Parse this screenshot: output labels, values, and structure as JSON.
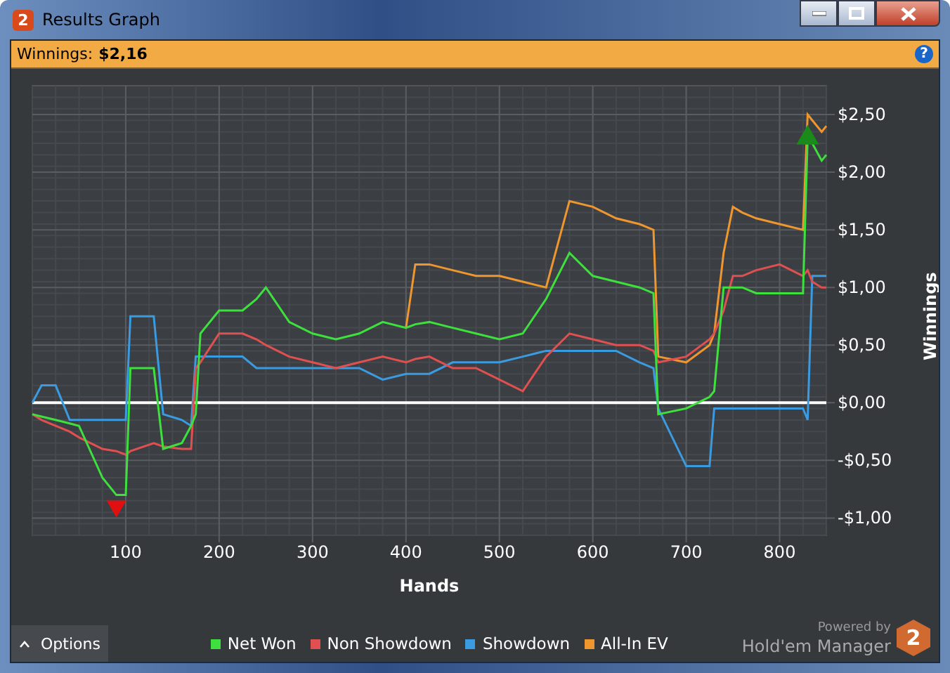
{
  "window": {
    "title": "Results Graph",
    "icon_badge": "2"
  },
  "summary": {
    "label": "Winnings:",
    "value": "$2,16",
    "help": "?"
  },
  "chart": {
    "show_extremes": true,
    "chart_data": {
      "type": "line",
      "grid": true,
      "xlabel": "Hands",
      "ylabel": "Winnings",
      "xlim": [
        0,
        850
      ],
      "ylim": [
        -1.15,
        2.75
      ],
      "xticks": [
        100,
        200,
        300,
        400,
        500,
        600,
        700,
        800
      ],
      "yticks": [
        {
          "value": 2.5,
          "label": "$2,50"
        },
        {
          "value": 2,
          "label": "$2,00"
        },
        {
          "value": 1.5,
          "label": "$1,50"
        },
        {
          "value": 1,
          "label": "$1,00"
        },
        {
          "value": 0.5,
          "label": "$0,50"
        },
        {
          "value": 0,
          "label": "$0,00"
        },
        {
          "value": -0.5,
          "label": "-$0,50"
        },
        {
          "value": -1,
          "label": "-$1,00"
        }
      ],
      "x": [
        0,
        10,
        25,
        40,
        50,
        75,
        90,
        100,
        105,
        130,
        140,
        160,
        170,
        175,
        180,
        200,
        225,
        240,
        250,
        275,
        300,
        325,
        350,
        375,
        400,
        410,
        425,
        450,
        475,
        500,
        525,
        550,
        575,
        600,
        625,
        650,
        665,
        670,
        700,
        725,
        730,
        740,
        750,
        760,
        775,
        800,
        825,
        830,
        835,
        845,
        850
      ],
      "series": [
        {
          "name": "Net Won",
          "color": "#3ee03e",
          "values": [
            -0.1,
            -0.12,
            -0.15,
            -0.18,
            -0.2,
            -0.65,
            -0.8,
            -0.8,
            0.3,
            0.3,
            -0.4,
            -0.35,
            -0.2,
            -0.1,
            0.6,
            0.8,
            0.8,
            0.9,
            1.0,
            0.7,
            0.6,
            0.55,
            0.6,
            0.7,
            0.65,
            0.68,
            0.7,
            0.65,
            0.6,
            0.55,
            0.6,
            0.9,
            1.3,
            1.1,
            1.05,
            1.0,
            0.95,
            -0.1,
            -0.05,
            0.05,
            0.1,
            1.0,
            1.0,
            1.0,
            0.95,
            0.95,
            0.95,
            2.3,
            2.25,
            2.1,
            2.15
          ]
        },
        {
          "name": "Non Showdown",
          "color": "#e05050",
          "values": [
            -0.1,
            -0.15,
            -0.2,
            -0.25,
            -0.3,
            -0.4,
            -0.42,
            -0.45,
            -0.42,
            -0.35,
            -0.38,
            -0.4,
            -0.4,
            0.3,
            0.35,
            0.6,
            0.6,
            0.55,
            0.5,
            0.4,
            0.35,
            0.3,
            0.35,
            0.4,
            0.35,
            0.38,
            0.4,
            0.3,
            0.3,
            0.2,
            0.1,
            0.4,
            0.6,
            0.55,
            0.5,
            0.5,
            0.45,
            0.35,
            0.4,
            0.55,
            0.6,
            0.8,
            1.1,
            1.1,
            1.15,
            1.2,
            1.1,
            1.15,
            1.05,
            1.0,
            1.0
          ]
        },
        {
          "name": "Showdown",
          "color": "#3a9be0",
          "values": [
            0,
            0.15,
            0.15,
            -0.15,
            -0.15,
            -0.15,
            -0.15,
            -0.15,
            0.75,
            0.75,
            -0.1,
            -0.15,
            -0.2,
            0.4,
            0.4,
            0.4,
            0.4,
            0.3,
            0.3,
            0.3,
            0.3,
            0.3,
            0.3,
            0.2,
            0.25,
            0.25,
            0.25,
            0.35,
            0.35,
            0.35,
            0.4,
            0.45,
            0.45,
            0.45,
            0.45,
            0.35,
            0.3,
            -0.05,
            -0.55,
            -0.55,
            -0.05,
            -0.05,
            -0.05,
            -0.05,
            -0.05,
            -0.05,
            -0.05,
            -0.15,
            1.1,
            1.1,
            1.1
          ]
        },
        {
          "name": "All-In EV",
          "color": "#f0962e",
          "values": [
            null,
            null,
            null,
            null,
            null,
            null,
            null,
            null,
            null,
            null,
            null,
            null,
            null,
            null,
            null,
            null,
            null,
            null,
            null,
            null,
            null,
            null,
            null,
            null,
            0.65,
            1.2,
            1.2,
            1.15,
            1.1,
            1.1,
            1.05,
            1.0,
            1.75,
            1.7,
            1.6,
            1.55,
            1.5,
            0.4,
            0.35,
            0.5,
            0.6,
            1.3,
            1.7,
            1.65,
            1.6,
            1.55,
            1.5,
            2.5,
            2.45,
            2.35,
            2.4
          ]
        }
      ]
    }
  },
  "options_button": {
    "label": "Options"
  },
  "branding": {
    "tagline": "Powered by",
    "name": "Hold'em Manager",
    "badge": "2"
  }
}
